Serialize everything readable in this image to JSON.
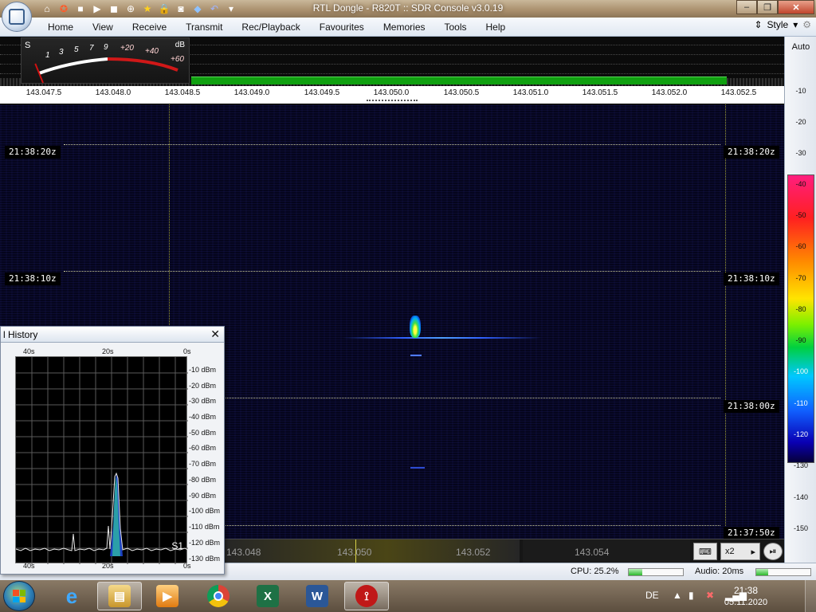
{
  "window": {
    "title": "RTL Dongle - R820T :: SDR Console v3.0.19",
    "controls": [
      "minimize",
      "maximize",
      "close"
    ]
  },
  "quick_access_icons": [
    "home-icon",
    "lifebuoy-icon",
    "stop-icon",
    "play-icon",
    "stop-square-icon",
    "plus-circle-icon",
    "star-icon",
    "lock-icon",
    "camera-icon",
    "drop-icon",
    "undo-icon",
    "chevron-down-icon"
  ],
  "menu": {
    "tabs": [
      "Home",
      "View",
      "Receive",
      "Transmit",
      "Rec/Playback",
      "Favourites",
      "Memories",
      "Tools",
      "Help"
    ],
    "style_label": "Style"
  },
  "smeter": {
    "s_label": "S",
    "db_label": "dB",
    "ticks": [
      "1",
      "3",
      "5",
      "7",
      "9",
      "+20",
      "+40",
      "+60"
    ]
  },
  "freq_ruler": {
    "labels": [
      "143.047.5",
      "143.048.0",
      "143.048.5",
      "143.049.0",
      "143.049.5",
      "143.050.0",
      "143.050.5",
      "143.051.0",
      "143.051.5",
      "143.052.0",
      "143.052.5"
    ]
  },
  "db_scale": {
    "auto_label": "Auto",
    "labels": [
      "-10",
      "-20",
      "-30",
      "-40",
      "-50",
      "-60",
      "-70",
      "-80",
      "-90",
      "-100",
      "-110",
      "-120",
      "-130",
      "-140",
      "-150"
    ]
  },
  "waterfall": {
    "time_tags": [
      "21:38:20z",
      "21:38:10z",
      "21:38:00z",
      "21:37:50z"
    ]
  },
  "bottom_freq": {
    "labels": [
      "143.048",
      "143.050",
      "143.052",
      "143.054"
    ],
    "zoom_label": "x2"
  },
  "status": {
    "cpu_label": "CPU: 25.2%",
    "cpu_percent": 25.2,
    "audio_label": "Audio: 20ms",
    "audio_fill_percent": 22
  },
  "history": {
    "title": "l History",
    "time_labels": [
      "40s",
      "20s",
      "0s"
    ],
    "db_labels": [
      "-10 dBm",
      "-20 dBm",
      "-30 dBm",
      "-40 dBm",
      "-50 dBm",
      "-60 dBm",
      "-70 dBm",
      "-80 dBm",
      "-90 dBm",
      "-100 dBm",
      "-110 dBm",
      "-120 dBm",
      "-130 dBm"
    ],
    "s_label": "S1"
  },
  "taskbar": {
    "language": "DE",
    "time": "21:38",
    "date": "05.11.2020",
    "apps": [
      "internet-explorer-icon",
      "file-explorer-icon",
      "media-player-icon",
      "chrome-icon",
      "excel-icon",
      "word-icon",
      "sdr-console-icon"
    ]
  }
}
